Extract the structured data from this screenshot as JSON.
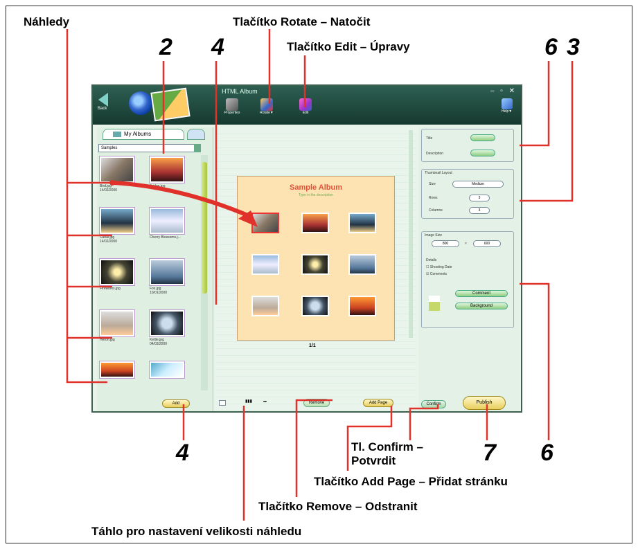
{
  "callouts": {
    "nahledy": "Náhledy",
    "rotate": "Tlačítko Rotate – Natočit",
    "edit": "Tlačítko Edit – Úpravy",
    "confirm_line1": "Tl. Confirm –",
    "confirm_line2": "Potvrdit",
    "add_page": "Tlačítko Add Page – Přidat stránku",
    "remove": "Tlačítko Remove – Odstranit",
    "slider": "Táhlo pro nastavení velikosti náhledu"
  },
  "numbers": {
    "n2": "2",
    "n4_top": "4",
    "n6_top": "6",
    "n3": "3",
    "n4_bottom": "4",
    "n7": "7",
    "n6_bottom": "6"
  },
  "app": {
    "title": "HTML Album",
    "back": "Back",
    "toolbar": {
      "properties": "Properties",
      "rotate": "Rotate▼",
      "edit": "Edit",
      "help": "Help▼"
    },
    "tab_albums": "My Albums",
    "album_select": "Samples",
    "thumbs": [
      {
        "caption": "Bird.jpg\n14/02/2000"
      },
      {
        "caption": "Bridge.jpg"
      },
      {
        "caption": "Canal.jpg\n14/02/2000"
      },
      {
        "caption": "Cherry Blossoms.j..."
      },
      {
        "caption": "Fireworks.jpg"
      },
      {
        "caption": "Fox.jpg\n10/01/2000"
      },
      {
        "caption": "Heron.jpg"
      },
      {
        "caption": "Kettle.jpg\n04/03/2000"
      }
    ],
    "add": "Add",
    "album_title": "Sample Album",
    "album_sub": "Type in the description",
    "page_num": "1/1",
    "remove_btn": "Remove",
    "add_page_btn": "Add Page",
    "title_lbl": "Title",
    "desc_lbl": "Description",
    "thumb_layout": "Thumbnail Layout",
    "size_lbl": "Size",
    "size_val": "Medium",
    "rows_lbl": "Rows",
    "rows_val": "3",
    "cols_lbl": "Columns",
    "cols_val": "3",
    "image_size": "Image Size",
    "w_val": "800",
    "h_val": "600",
    "details": "Details",
    "shooting_date": "Shooting Date",
    "comments": "Comments",
    "comment_btn": "Comment",
    "background_btn": "Background",
    "confirm_btn": "Confirm",
    "publish_btn": "Publish"
  },
  "colors": {
    "pointer_line": "#e0322b",
    "window_bg": "#e8f3ea"
  }
}
